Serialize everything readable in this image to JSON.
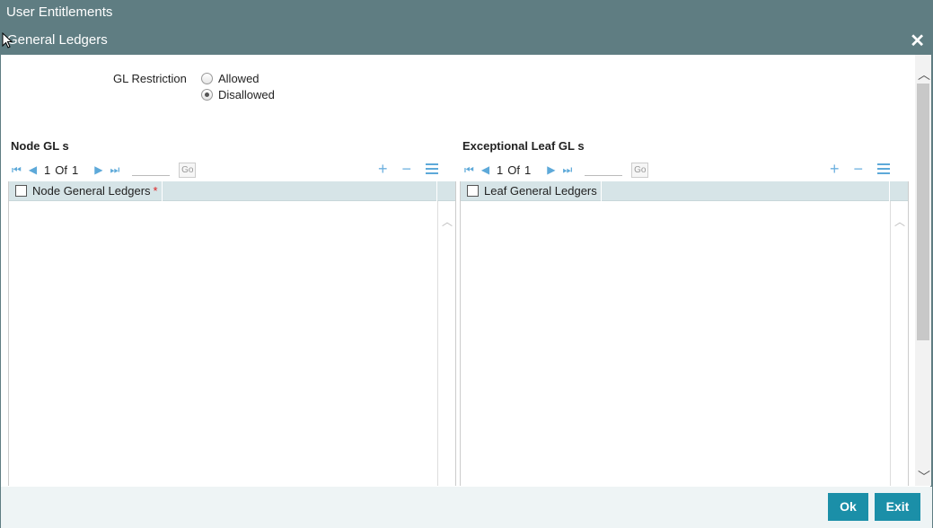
{
  "window": {
    "title": "User Entitlements"
  },
  "dialog": {
    "title": "General Ledgers",
    "close_symbol": "✕"
  },
  "restriction": {
    "label": "GL Restriction",
    "options": [
      {
        "label": "Allowed",
        "checked": false
      },
      {
        "label": "Disallowed",
        "checked": true
      }
    ]
  },
  "node_section": {
    "title": "Node GL s",
    "pager": {
      "current": "1",
      "of": "Of",
      "total": "1",
      "go_label": "Go"
    },
    "column": "Node General Ledgers",
    "required_mark": "*"
  },
  "leaf_section": {
    "title": "Exceptional Leaf GL s",
    "pager": {
      "current": "1",
      "of": "Of",
      "total": "1",
      "go_label": "Go"
    },
    "column": "Leaf General Ledgers"
  },
  "footer": {
    "ok_label": "Ok",
    "exit_label": "Exit"
  },
  "colors": {
    "header": "#5f7d82",
    "accent": "#1b8fa8",
    "grid_header": "#d6e4e7",
    "required": "#dd2222"
  }
}
